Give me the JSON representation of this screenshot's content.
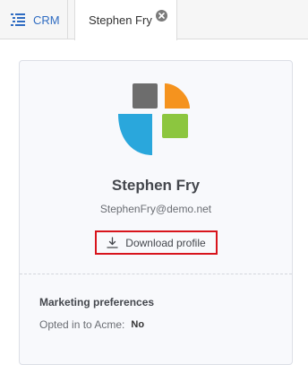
{
  "tabs": {
    "crm": {
      "label": "CRM",
      "icon": "list-icon"
    },
    "active": {
      "label": "Stephen Fry",
      "close_icon": "close-circle-icon"
    }
  },
  "profile": {
    "logo_icon": "company-logo",
    "name": "Stephen Fry",
    "email": "StephenFry@demo.net",
    "download_label": "Download profile",
    "download_icon": "download-icon"
  },
  "marketing": {
    "title": "Marketing preferences",
    "opted_label": "Opted in to Acme:",
    "opted_value": "No"
  },
  "colors": {
    "link": "#2f6cc2",
    "highlight": "#d8141c",
    "logo_gray": "#6d6d6d",
    "logo_orange": "#f5931e",
    "logo_blue": "#2aa7dc",
    "logo_green": "#8cc63f"
  }
}
